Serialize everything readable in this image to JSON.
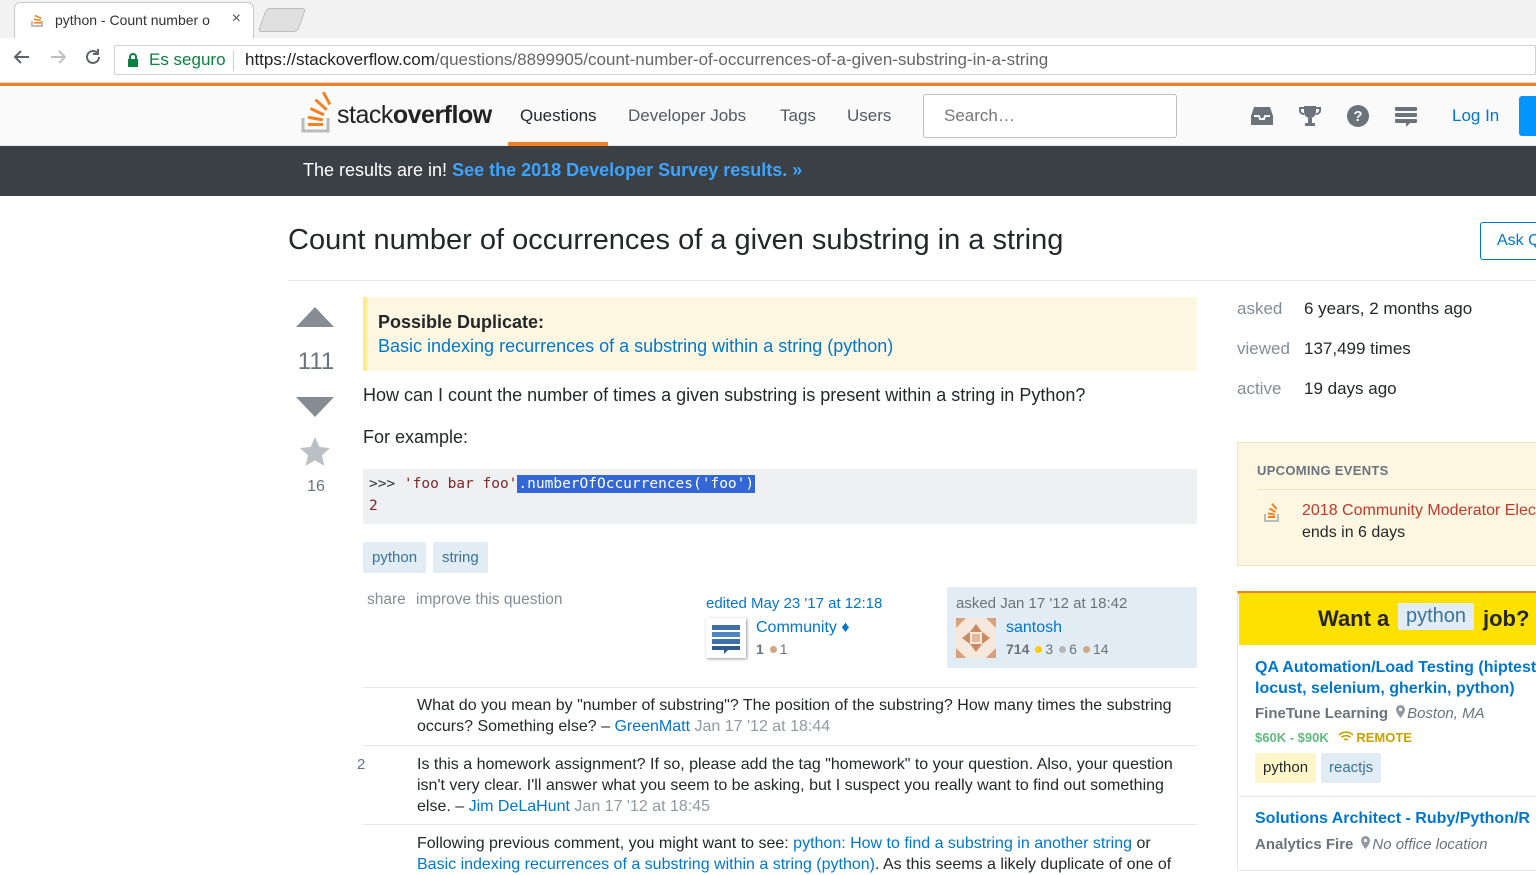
{
  "browser": {
    "tab_title": "python - Count number o",
    "close_glyph": "×",
    "secure_label": "Es seguro",
    "url_host": "https://stackoverflow.com",
    "url_path": "/questions/8899905/count-number-of-occurrences-of-a-given-substring-in-a-string"
  },
  "header": {
    "logo_light": "stack",
    "logo_bold": "overflow",
    "nav": [
      "Questions",
      "Developer Jobs",
      "Tags",
      "Users"
    ],
    "search_placeholder": "Search…",
    "login": "Log In",
    "icons": [
      "inbox-icon",
      "achievements-icon",
      "help-icon",
      "site-switcher-icon"
    ]
  },
  "banner": {
    "text": "The results are in! ",
    "link": "See the 2018 Developer Survey results. »"
  },
  "question": {
    "title": "Count number of occurrences of a given substring in a string",
    "ask_button": "Ask Q",
    "votes": "111",
    "favorites": "16",
    "duplicate_heading": "Possible Duplicate:",
    "duplicate_link": "Basic indexing recurrences of a substring within a string (python)",
    "body_p1": "How can I count the number of times a given substring is present within a string in Python?",
    "body_p2": "For example:",
    "code_prompt": ">>> ",
    "code_string": "'foo bar foo'",
    "code_selected": ".numberOfOccurrences('foo')",
    "code_output": "2",
    "tags": [
      "python",
      "string"
    ],
    "menu_share": "share",
    "menu_improve": "improve this question",
    "edited": "edited May 23 '17 at 12:18",
    "editor_name": "Community ♦",
    "editor_rep": "1",
    "editor_bronze": "1",
    "asked_label": "asked Jan 17 '12 at 18:42",
    "owner_name": "santosh",
    "owner_rep": "714",
    "owner_gold": "3",
    "owner_silver": "6",
    "owner_bronze": "14"
  },
  "comments": [
    {
      "score": "",
      "text": "What do you mean by \"number of substring\"? The position of the substring? How many times the substring occurs? Something else? – ",
      "user": "GreenMatt",
      "date": "Jan 17 '12 at 18:44"
    },
    {
      "score": "2",
      "text": "Is this a homework assignment? If so, please add the tag \"homework\" to your question. Also, your question isn't very clear. I'll answer what you seem to be asking, but I suspect you really want to find out something else. – ",
      "user": "Jim DeLaHunt",
      "date": "Jan 17 '12 at 18:45"
    },
    {
      "score": "",
      "text_before": "Following previous comment, you might want to see: ",
      "link1": "python: How to find a substring in another string",
      "text_mid": " or ",
      "link2": "Basic indexing recurrences of a substring within a string (python)",
      "text_after": ". As this seems a likely duplicate of one of"
    }
  ],
  "sidebar": {
    "stats": [
      {
        "label": "asked",
        "value": "6 years, 2 months ago"
      },
      {
        "label": "viewed",
        "value": "137,499 times"
      },
      {
        "label": "active",
        "value": "19 days ago"
      }
    ],
    "events_heading": "UPCOMING EVENTS",
    "event_title": "2018 Community Moderator Elec",
    "event_sub": "ends in 6 days",
    "jobs_want": "Want a",
    "jobs_tag": "python",
    "jobs_job": "job?",
    "job1_title": "QA Automation/Load Testing (hiptest, locust, selenium, gherkin, python)",
    "job1_company": "FineTune Learning",
    "job1_location": "Boston, MA",
    "job1_salary": "$60K - $90K",
    "job1_remote": "REMOTE",
    "job1_tags": [
      "python",
      "reactjs"
    ],
    "job2_title": "Solutions Architect - Ruby/Python/R",
    "job2_company": "Analytics Fire",
    "job2_location": "No office location"
  },
  "colors": {
    "accent": "#f48024",
    "link": "#0077cc",
    "banner": "#3b4045"
  }
}
